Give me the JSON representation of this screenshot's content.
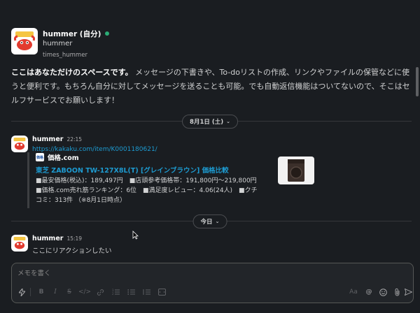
{
  "intro": {
    "name": "hummer (自分)",
    "display_name": "hummer",
    "channel": "times_hummer",
    "text_bold": "ここはあなただけのスペースです。",
    "text_rest": " メッセージの下書きや、To-doリストの作成、リンクやファイルの保管などに使うと便利です。もちろん自分に対してメッセージを送ることも可能。でも自動返信機能はついてないので、そこはセルフサービスでお願いします！"
  },
  "dividers": {
    "first": "8月1日 (土)",
    "second": "今日"
  },
  "messages": [
    {
      "author": "hummer",
      "time": "22:15",
      "link": "https://kakaku.com/item/K0001180621/",
      "unfurl": {
        "site_icon_text": "価格",
        "site": "価格.com",
        "title": "東芝 ZABOON TW-127X8L(T) [グレインブラウン] 価格比較",
        "desc": "■最安価格(税込)：189,497円　■店頭参考価格帯：191,800円〜219,800円　■価格.com売れ筋ランキング：6位　■満足度レビュー：4.06(24人)　■クチコミ：313件 （※8月1日時点）"
      }
    },
    {
      "author": "hummer",
      "time": "15:19",
      "text": "ここにリアクションしたい"
    }
  ],
  "composer": {
    "placeholder": "メモを書く"
  },
  "icons": {
    "toolbar": [
      "lightning-icon",
      "bold-icon",
      "italic-icon",
      "strike-icon",
      "code-icon",
      "link-icon",
      "ordered-list-icon",
      "bullet-list-icon",
      "block-quote-icon",
      "mention-icon",
      "emoji-icon",
      "attach-icon",
      "send-icon"
    ]
  },
  "colors": {
    "background": "#1a1d21",
    "link": "#1d9bd1",
    "presence": "#2bac76"
  }
}
